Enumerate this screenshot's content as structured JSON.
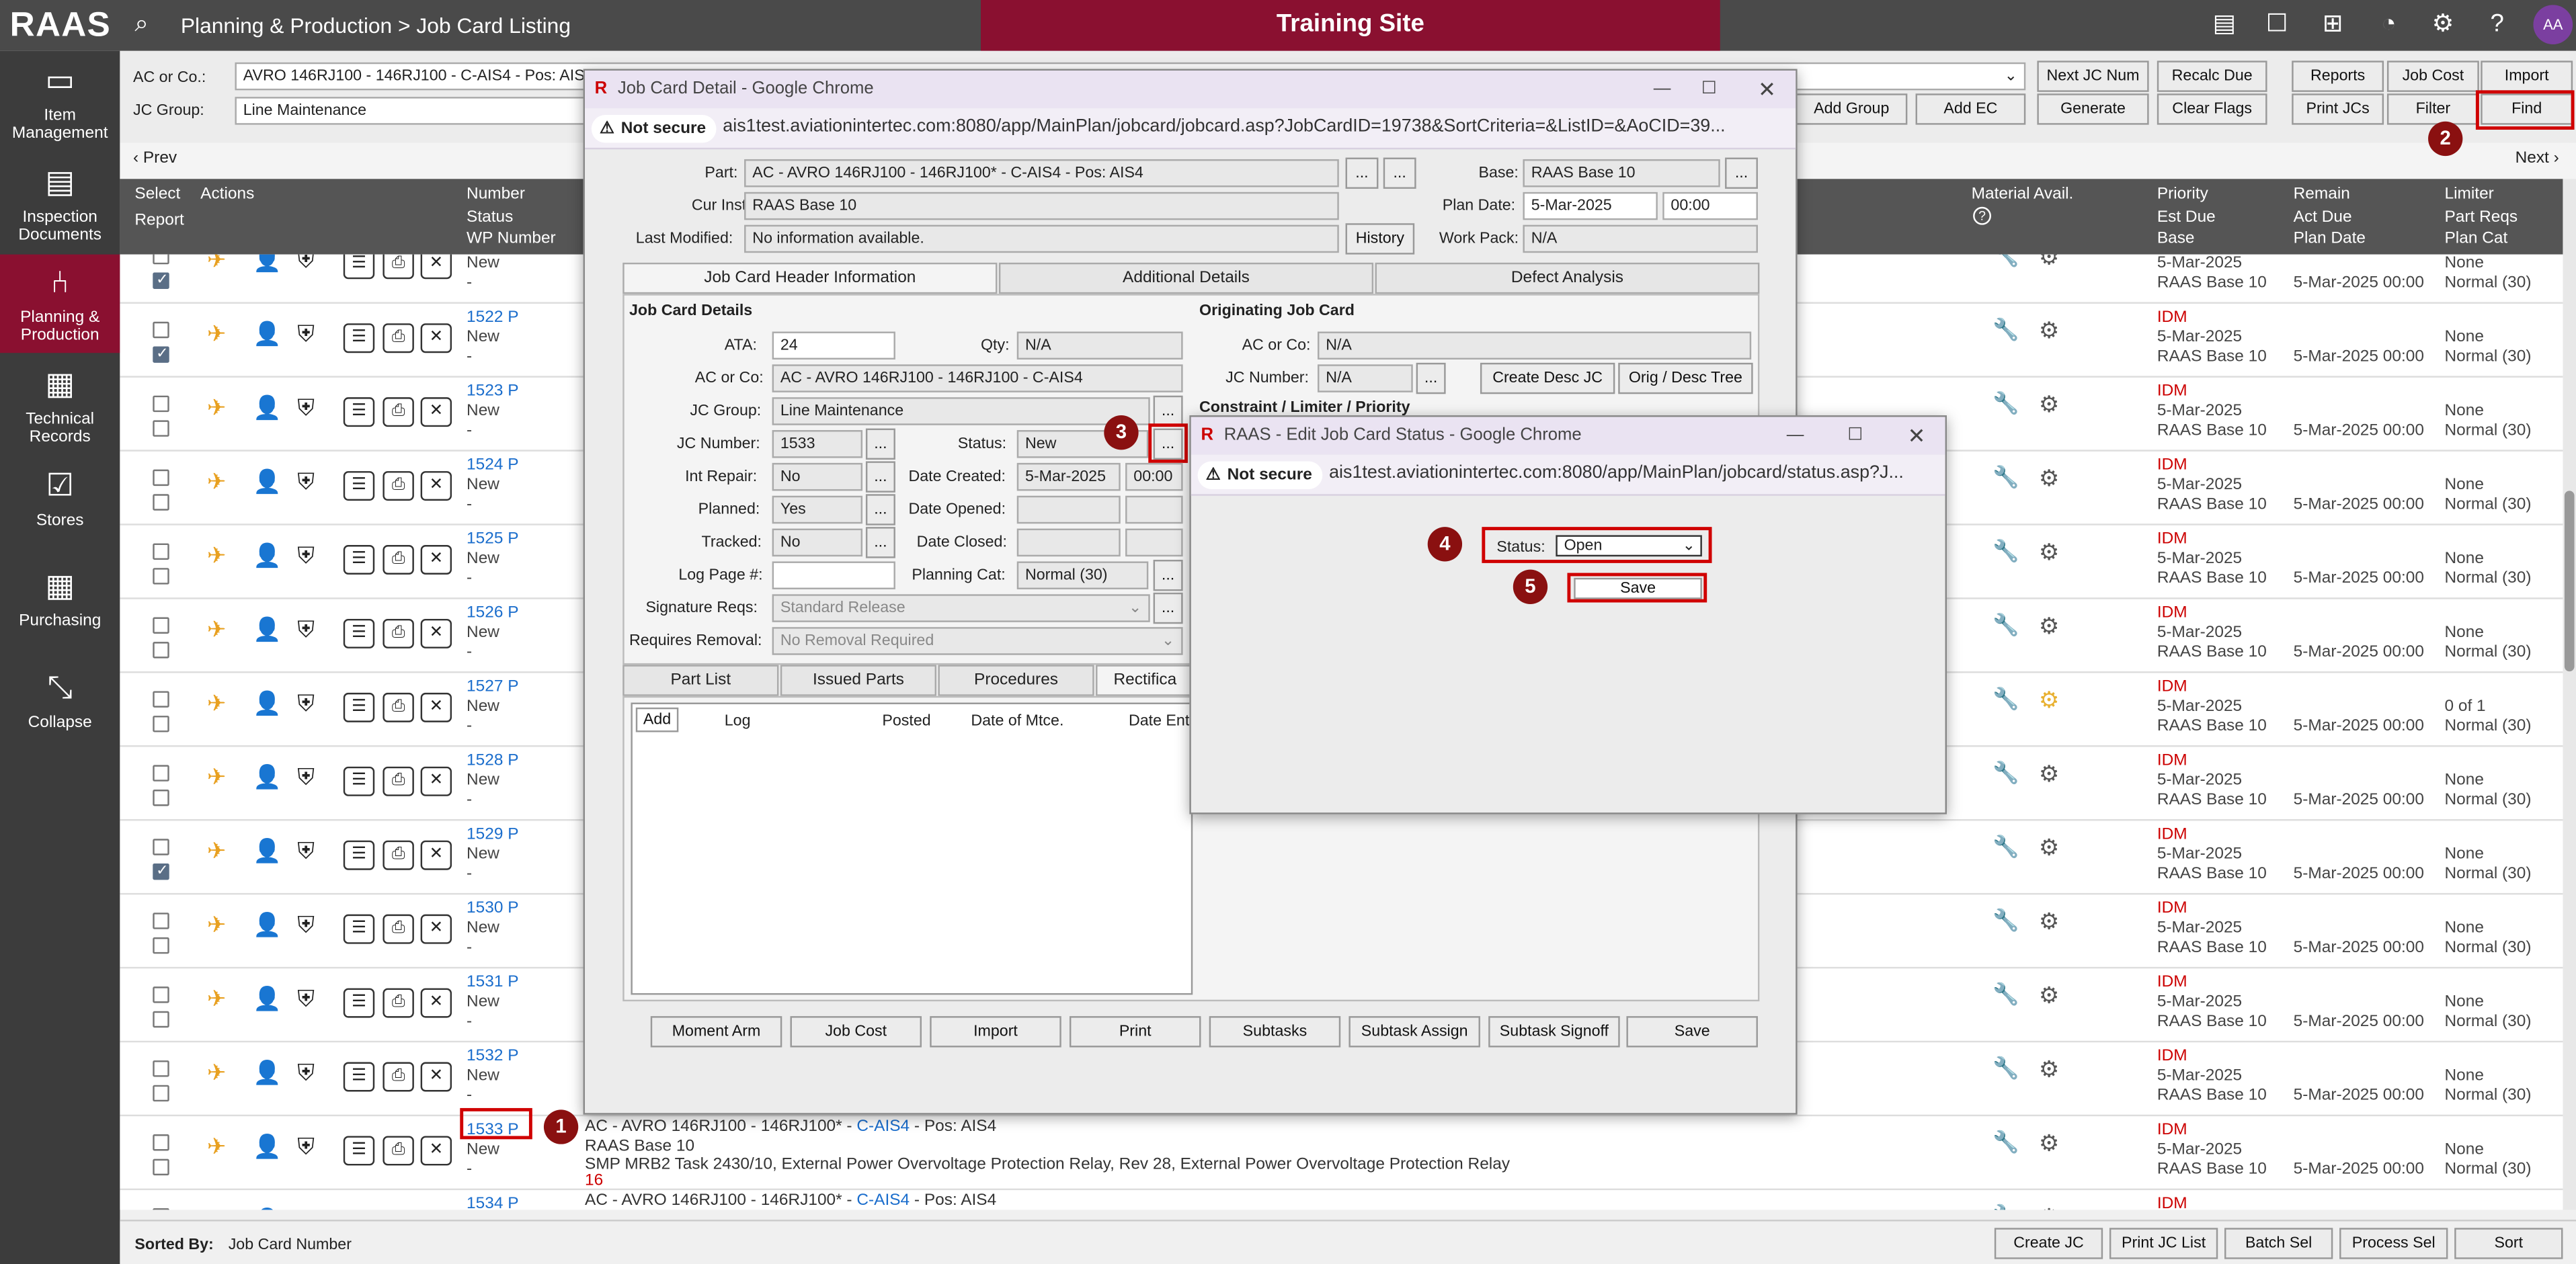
{
  "app": {
    "logo": "RAAS",
    "breadcrumb": "Planning & Production > Job Card Listing",
    "site_banner": "Training Site",
    "user_initials": "AA"
  },
  "sidebar": {
    "items": [
      "Item Management",
      "Inspection Documents",
      "Planning & Production",
      "Technical Records",
      "Stores",
      "Purchasing",
      "Collapse"
    ]
  },
  "filter": {
    "ac_label": "AC or Co.:",
    "ac_value": "AVRO 146RJ100 - 146RJ100 - C-AIS4 - Pos: AIS4",
    "jc_group_label": "JC Group:",
    "jc_group_value": "Line Maintenance",
    "buttons": [
      "Next JC Num",
      "Recalc Due",
      "Add Group",
      "Add EC",
      "Generate",
      "Clear Flags",
      "Reports",
      "Job Cost",
      "Import",
      "Print JCs",
      "Filter",
      "Find"
    ]
  },
  "pager": {
    "prev": "‹ Prev",
    "next": "Next ›"
  },
  "columns": {
    "select": "Select",
    "report": "Report",
    "actions": "Actions",
    "number": "Number",
    "status": "Status",
    "wp_number": "WP Number",
    "material": "Material Avail.",
    "priority": "Priority",
    "est_due": "Est Due",
    "base": "Base",
    "remain": "Remain",
    "act_due": "Act Due",
    "plan_date": "Plan Date",
    "limiter": "Limiter",
    "part_reqs": "Part Reqs",
    "plan_cat": "Plan Cat"
  },
  "rows": [
    {
      "number": "",
      "status": "New",
      "wp": "-",
      "priority": "",
      "due": "5-Mar-2025",
      "base": "RAAS Base 10",
      "plan_date": "5-Mar-2025 00:00",
      "part_reqs": "None",
      "plan_cat": "Normal (30)"
    },
    {
      "number": "1522 P",
      "status": "New",
      "wp": "-",
      "priority": "IDM",
      "due": "5-Mar-2025",
      "base": "RAAS Base 10",
      "plan_date": "5-Mar-2025 00:00",
      "part_reqs": "None",
      "plan_cat": "Normal (30)"
    },
    {
      "number": "1523 P",
      "status": "New",
      "wp": "-",
      "priority": "IDM",
      "due": "5-Mar-2025",
      "base": "RAAS Base 10",
      "plan_date": "5-Mar-2025 00:00",
      "part_reqs": "None",
      "plan_cat": "Normal (30)"
    },
    {
      "number": "1524 P",
      "status": "New",
      "wp": "-",
      "priority": "IDM",
      "due": "5-Mar-2025",
      "base": "RAAS Base 10",
      "plan_date": "5-Mar-2025 00:00",
      "part_reqs": "None",
      "plan_cat": "Normal (30)"
    },
    {
      "number": "1525 P",
      "status": "New",
      "wp": "-",
      "priority": "IDM",
      "due": "5-Mar-2025",
      "base": "RAAS Base 10",
      "plan_date": "5-Mar-2025 00:00",
      "part_reqs": "None",
      "plan_cat": "Normal (30)"
    },
    {
      "number": "1526 P",
      "status": "New",
      "wp": "-",
      "priority": "IDM",
      "due": "5-Mar-2025",
      "base": "RAAS Base 10",
      "plan_date": "5-Mar-2025 00:00",
      "part_reqs": "None",
      "plan_cat": "Normal (30)"
    },
    {
      "number": "1527 P",
      "status": "New",
      "wp": "-",
      "priority": "IDM",
      "due": "5-Mar-2025",
      "base": "RAAS Base 10",
      "plan_date": "5-Mar-2025 00:00",
      "part_reqs": "0 of 1",
      "plan_cat": "Normal (30)"
    },
    {
      "number": "1528 P",
      "status": "New",
      "wp": "-",
      "priority": "IDM",
      "due": "5-Mar-2025",
      "base": "RAAS Base 10",
      "plan_date": "5-Mar-2025 00:00",
      "part_reqs": "None",
      "plan_cat": "Normal (30)"
    },
    {
      "number": "1529 P",
      "status": "New",
      "wp": "-",
      "priority": "IDM",
      "due": "5-Mar-2025",
      "base": "RAAS Base 10",
      "plan_date": "5-Mar-2025 00:00",
      "part_reqs": "None",
      "plan_cat": "Normal (30)"
    },
    {
      "number": "1530 P",
      "status": "New",
      "wp": "-",
      "priority": "IDM",
      "due": "5-Mar-2025",
      "base": "RAAS Base 10",
      "plan_date": "5-Mar-2025 00:00",
      "part_reqs": "None",
      "plan_cat": "Normal (30)"
    },
    {
      "number": "1531 P",
      "status": "New",
      "wp": "-",
      "priority": "IDM",
      "due": "5-Mar-2025",
      "base": "RAAS Base 10",
      "plan_date": "5-Mar-2025 00:00",
      "part_reqs": "None",
      "plan_cat": "Normal (30)"
    },
    {
      "number": "1532 P",
      "status": "New",
      "wp": "-",
      "priority": "IDM",
      "due": "5-Mar-2025",
      "base": "RAAS Base 10",
      "plan_date": "5-Mar-2025 00:00",
      "part_reqs": "None",
      "plan_cat": "Normal (30)"
    },
    {
      "number": "1533 P",
      "status": "New",
      "wp": "-",
      "priority": "IDM",
      "due": "5-Mar-2025",
      "base": "RAAS Base 10",
      "plan_date": "5-Mar-2025 00:00",
      "part_reqs": "None",
      "plan_cat": "Normal (30)"
    },
    {
      "number": "1534 P",
      "status": "",
      "wp": "",
      "priority": "IDM",
      "due": "",
      "base": "",
      "plan_date": "",
      "part_reqs": "",
      "plan_cat": ""
    }
  ],
  "row1533_detail": {
    "ac_prefix": "AC - AVRO 146RJ100 - 146RJ100* - ",
    "ac_link": "C-AIS4",
    "ac_suffix": " - Pos: AIS4",
    "base": "RAAS Base 10",
    "description": "SMP MRB2 Task 2430/10, External Power Overvoltage Protection Relay, Rev 28, External Power Overvoltage Protection Relay",
    "number": "16"
  },
  "row1534_detail": {
    "ac_prefix": "AC - AVRO 146RJ100 - 146RJ100* - ",
    "ac_link": "C-AIS4",
    "ac_suffix": " - Pos: AIS4"
  },
  "footer": {
    "sorted_by_label": "Sorted By:",
    "sorted_by_value": "Job Card Number",
    "buttons": [
      "Create JC",
      "Print JC List",
      "Batch Sel",
      "Process Sel",
      "Sort"
    ]
  },
  "jc_window": {
    "title": "Job Card Detail - Google Chrome",
    "not_secure": "Not secure",
    "url": "ais1test.aviationintertec.com:8080/app/MainPlan/jobcard/jobcard.asp?JobCardID=19738&SortCriteria=&ListID=&AoCID=39...",
    "part_label": "Part:",
    "part_value": "AC - AVRO 146RJ100 - 146RJ100* - C-AIS4 - Pos: AIS4",
    "cur_inst_label": "Cur Inst:",
    "cur_inst_value": "RAAS Base 10",
    "last_modified_label": "Last Modified:",
    "last_modified_value": "No information available.",
    "history_button": "History",
    "base_label": "Base:",
    "base_value": "RAAS Base 10",
    "plan_date_label": "Plan Date:",
    "plan_date_value": "5-Mar-2025",
    "plan_time_value": "00:00",
    "work_pack_label": "Work Pack:",
    "work_pack_value": "N/A",
    "tabs": [
      "Job Card Header Information",
      "Additional Details",
      "Defect Analysis"
    ],
    "details_header": "Job Card Details",
    "ata_label": "ATA:",
    "ata_value": "24",
    "qty_label": "Qty:",
    "qty_value": "N/A",
    "ac_label": "AC or Co:",
    "ac_value": "AC - AVRO 146RJ100 - 146RJ100 - C-AIS4",
    "jc_group_label": "JC Group:",
    "jc_group_value": "Line Maintenance",
    "jc_number_label": "JC Number:",
    "jc_number_value": "1533",
    "status_label": "Status:",
    "status_value": "New",
    "int_repair_label": "Int Repair:",
    "int_repair_value": "No",
    "date_created_label": "Date Created:",
    "date_created_value": "5-Mar-2025",
    "time_created_value": "00:00",
    "planned_label": "Planned:",
    "planned_value": "Yes",
    "date_opened_label": "Date Opened:",
    "tracked_label": "Tracked:",
    "tracked_value": "No",
    "date_closed_label": "Date Closed:",
    "log_page_label": "Log Page #:",
    "planning_cat_label": "Planning Cat:",
    "planning_cat_value": "Normal (30)",
    "sig_reqs_label": "Signature Reqs:",
    "sig_reqs_value": "Standard Release",
    "requires_removal_label": "Requires Removal:",
    "requires_removal_value": "No Removal Required",
    "orig_header": "Originating Job Card",
    "orig_ac_label": "AC or Co:",
    "orig_ac_value": "N/A",
    "orig_jc_label": "JC Number:",
    "orig_jc_value": "N/A",
    "create_desc_button": "Create Desc JC",
    "orig_desc_button": "Orig / Desc Tree",
    "constraint_header": "Constraint / Limiter / Priority",
    "bottom_tabs": [
      "Part List",
      "Issued Parts",
      "Procedures",
      "Rectifica"
    ],
    "log_add": "Add",
    "log_columns": [
      "Log",
      "Posted",
      "Date of Mtce.",
      "Date Ente"
    ],
    "buttons": [
      "Moment Arm",
      "Job Cost",
      "Import",
      "Print",
      "Subtasks",
      "Subtask Assign",
      "Subtask Signoff",
      "Save"
    ],
    "ellipsis": "..."
  },
  "status_window": {
    "title": "RAAS - Edit Job Card Status - Google Chrome",
    "not_secure": "Not secure",
    "url": "ais1test.aviationintertec.com:8080/app/MainPlan/jobcard/status.asp?J...",
    "status_label": "Status:",
    "status_value": "Open",
    "save_button": "Save"
  },
  "annotations": [
    "1",
    "2",
    "3",
    "4",
    "5"
  ],
  "colors": {
    "brand": "#8a1030",
    "topbar": "#4a4a4a",
    "annotation_box": "#d00000",
    "link": "#1a6dcc"
  }
}
